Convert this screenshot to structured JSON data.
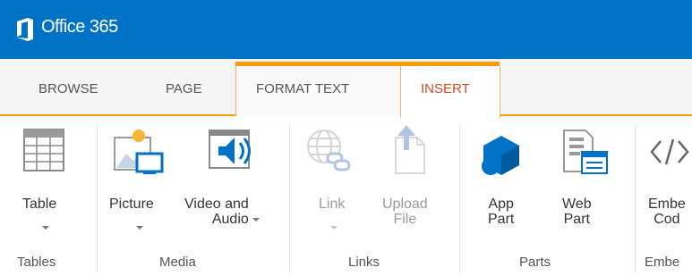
{
  "suite": {
    "product_name": "Office 365"
  },
  "tabs": [
    {
      "label": "BROWSE"
    },
    {
      "label": "PAGE"
    },
    {
      "label": "FORMAT TEXT"
    },
    {
      "label": "INSERT",
      "active": true
    }
  ],
  "colors": {
    "suite_bar": "#0072c6",
    "context_tab_accent": "#f59c00",
    "active_tab_text": "#d04d22",
    "app_blue": "#0072c6"
  },
  "groups": [
    {
      "label": "Tables",
      "commands": [
        {
          "label": "Table",
          "icon": "table-icon",
          "dropdown": true
        }
      ]
    },
    {
      "label": "Media",
      "commands": [
        {
          "label": "Picture",
          "icon": "picture-icon",
          "dropdown": true
        },
        {
          "label": "Video and\nAudio",
          "icon": "video-audio-icon",
          "dropdown": true
        }
      ]
    },
    {
      "label": "Links",
      "commands": [
        {
          "label": "Link",
          "icon": "link-icon",
          "dropdown": true,
          "disabled": true
        },
        {
          "label": "Upload\nFile",
          "icon": "upload-file-icon",
          "disabled": true
        }
      ]
    },
    {
      "label": "Parts",
      "commands": [
        {
          "label": "App\nPart",
          "icon": "app-part-icon"
        },
        {
          "label": "Web\nPart",
          "icon": "web-part-icon"
        }
      ]
    },
    {
      "label": "Embe",
      "commands": [
        {
          "label": "Embe\nCod",
          "icon": "embed-code-icon"
        }
      ]
    }
  ]
}
